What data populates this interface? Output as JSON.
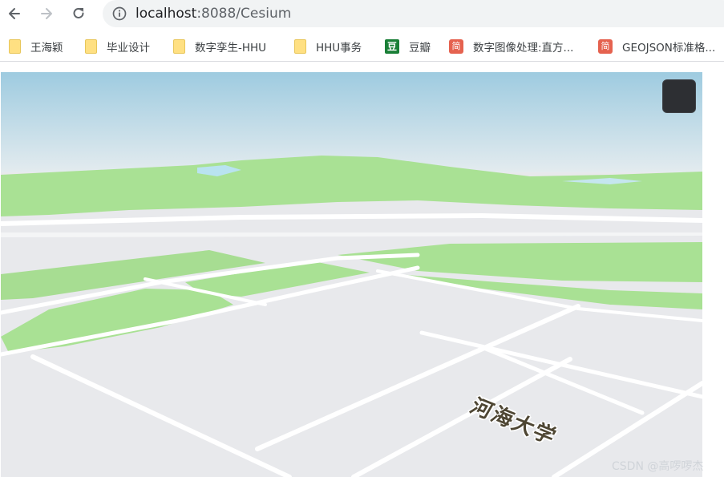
{
  "browser": {
    "url_host": "localhost",
    "url_path": ":8088/Cesium"
  },
  "bookmarks": [
    {
      "label": "王海颖",
      "icon": "folder-icon"
    },
    {
      "label": "毕业设计",
      "icon": "folder-icon"
    },
    {
      "label": "数字孪生-HHU",
      "icon": "folder-icon"
    },
    {
      "label": "HHU事务",
      "icon": "folder-icon"
    },
    {
      "label": "豆瓣",
      "icon": "douban-icon",
      "glyph": "豆"
    },
    {
      "label": "数字图像处理:直方...",
      "icon": "jianshu-icon",
      "glyph": "简"
    },
    {
      "label": "GEOJSON标准格...",
      "icon": "jianshu-icon",
      "glyph": "简"
    }
  ],
  "map": {
    "campus_label": "河海大学",
    "colors": {
      "sky_top": "#9ecbe0",
      "sky_bottom": "#e9eef0",
      "ground": "#e8e9ec",
      "park": "#a9e194",
      "road": "#ffffff"
    }
  },
  "watermark": "CSDN @高啰啰杰"
}
